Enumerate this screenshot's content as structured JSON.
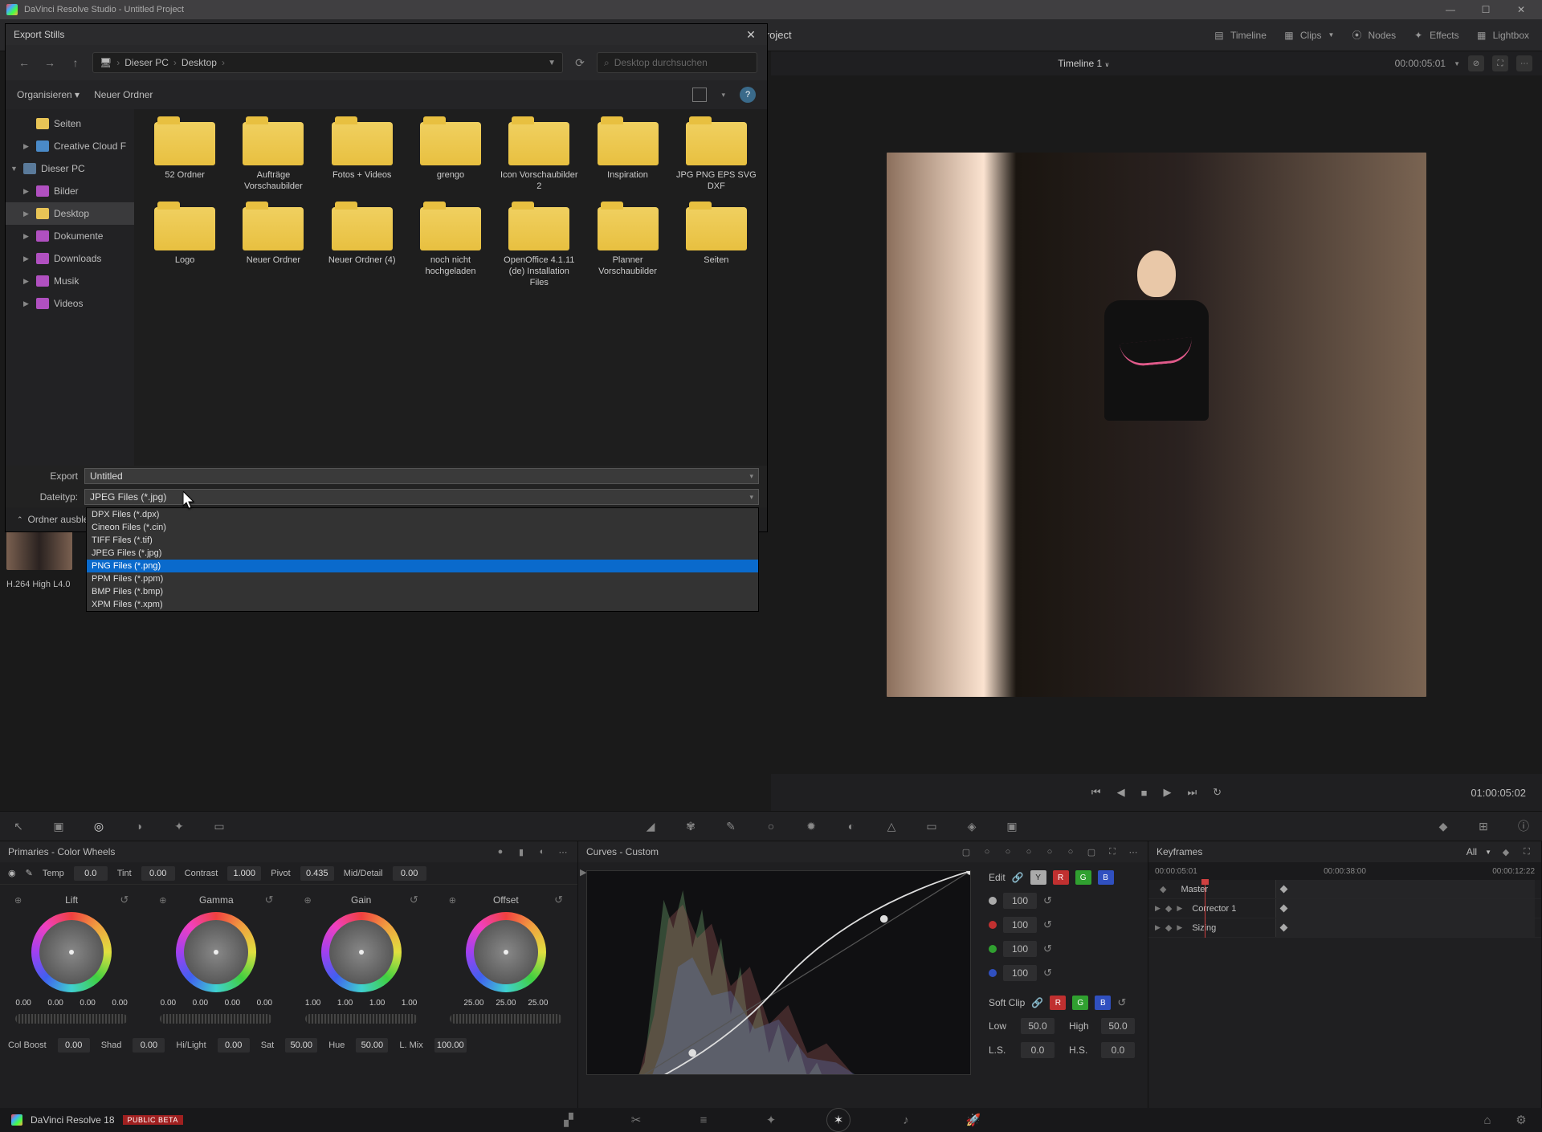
{
  "titlebar": {
    "title": "DaVinci Resolve Studio - Untitled Project"
  },
  "toolbar": {
    "project": "d Project",
    "timeline": "Timeline",
    "clips": "Clips",
    "nodes": "Nodes",
    "effects": "Effects",
    "lightbox": "Lightbox"
  },
  "viewer": {
    "timeline_name": "Timeline 1",
    "tc_left": "00:00:05:01",
    "tc_right": "01:00:05:02"
  },
  "dialog": {
    "title": "Export Stills",
    "breadcrumb": [
      "Dieser PC",
      "Desktop"
    ],
    "search_placeholder": "Desktop durchsuchen",
    "organize": "Organisieren",
    "new_folder": "Neuer Ordner",
    "tree": [
      {
        "label": "Seiten",
        "icon": "folder",
        "indent": 1
      },
      {
        "label": "Creative Cloud F",
        "icon": "cloud",
        "indent": 1,
        "exp": "▶"
      },
      {
        "label": "Dieser PC",
        "icon": "pc",
        "indent": 0,
        "exp": "▼"
      },
      {
        "label": "Bilder",
        "icon": "pic",
        "indent": 1,
        "exp": "▶"
      },
      {
        "label": "Desktop",
        "icon": "folder",
        "indent": 1,
        "exp": "▶",
        "selected": true
      },
      {
        "label": "Dokumente",
        "icon": "doc",
        "indent": 1,
        "exp": "▶"
      },
      {
        "label": "Downloads",
        "icon": "dl",
        "indent": 1,
        "exp": "▶"
      },
      {
        "label": "Musik",
        "icon": "music",
        "indent": 1,
        "exp": "▶"
      },
      {
        "label": "Videos",
        "icon": "video",
        "indent": 1,
        "exp": "▶"
      }
    ],
    "folders": [
      "52 Ordner",
      "Aufträge Vorschaubilder",
      "Fotos + Videos",
      "grengo",
      "Icon Vorschaubilder 2",
      "Inspiration",
      "JPG PNG EPS SVG DXF",
      "Logo",
      "Neuer Ordner",
      "Neuer Ordner (4)",
      "noch nicht hochgeladen",
      "OpenOffice 4.1.11 (de) Installation Files",
      "Planner Vorschaubilder",
      "Seiten"
    ],
    "export_label": "Export",
    "export_value": "Untitled",
    "filetype_label": "Dateityp:",
    "filetype_value": "JPEG Files (*.jpg)",
    "filetype_options": [
      "DPX Files (*.dpx)",
      "Cineon Files (*.cin)",
      "TIFF Files (*.tif)",
      "JPEG Files (*.jpg)",
      "PNG Files (*.png)",
      "PPM Files (*.ppm)",
      "BMP Files (*.bmp)",
      "XPM Files (*.xpm)"
    ],
    "filetype_highlight": 4,
    "hide_folders": "Ordner ausblende"
  },
  "codec": "H.264 High L4.0",
  "primaries": {
    "title": "Primaries - Color Wheels",
    "params": {
      "temp_label": "Temp",
      "temp": "0.0",
      "tint_label": "Tint",
      "tint": "0.00",
      "contrast_label": "Contrast",
      "contrast": "1.000",
      "pivot_label": "Pivot",
      "pivot": "0.435",
      "middetail_label": "Mid/Detail",
      "middetail": "0.00"
    },
    "wheels": [
      {
        "name": "Lift",
        "vals": [
          "0.00",
          "0.00",
          "0.00",
          "0.00"
        ]
      },
      {
        "name": "Gamma",
        "vals": [
          "0.00",
          "0.00",
          "0.00",
          "0.00"
        ]
      },
      {
        "name": "Gain",
        "vals": [
          "1.00",
          "1.00",
          "1.00",
          "1.00"
        ]
      },
      {
        "name": "Offset",
        "vals": [
          "25.00",
          "25.00",
          "25.00"
        ]
      }
    ],
    "secondary": {
      "colboost_label": "Col Boost",
      "colboost": "0.00",
      "shad_label": "Shad",
      "shad": "0.00",
      "hilight_label": "Hi/Light",
      "hilight": "0.00",
      "sat_label": "Sat",
      "sat": "50.00",
      "hue_label": "Hue",
      "hue": "50.00",
      "lmix_label": "L. Mix",
      "lmix": "100.00"
    }
  },
  "curves": {
    "title": "Curves - Custom",
    "edit_label": "Edit",
    "softclip_label": "Soft Clip",
    "low_label": "Low",
    "low": "50.0",
    "high_label": "High",
    "high": "50.0",
    "ls_label": "L.S.",
    "ls": "0.0",
    "hs_label": "H.S.",
    "hs": "0.0",
    "ch_vals": [
      "100",
      "100",
      "100",
      "100"
    ]
  },
  "keyframes": {
    "title": "Keyframes",
    "all": "All",
    "tc_start": "00:00:05:01",
    "tc_mid": "00:00:38:00",
    "tc_end": "00:00:12:22",
    "tracks": [
      {
        "name": "Master"
      },
      {
        "name": "Corrector 1"
      },
      {
        "name": "Sizing"
      }
    ]
  },
  "app": {
    "name": "DaVinci Resolve 18",
    "beta": "PUBLIC BETA"
  }
}
